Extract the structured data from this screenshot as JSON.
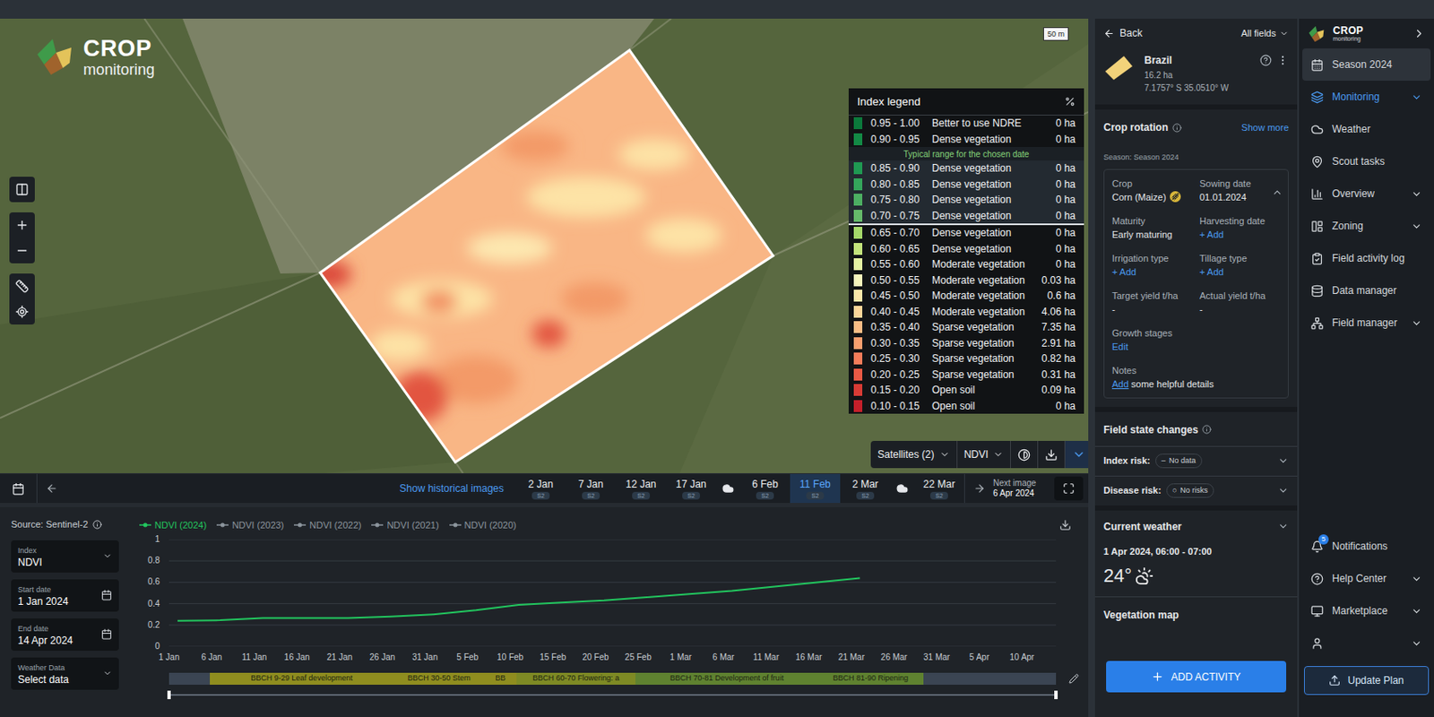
{
  "logo": {
    "title": "CROP",
    "subtitle": "monitoring"
  },
  "map": {
    "scale": "50 m",
    "legend": {
      "title": "Index legend",
      "typical_note": "Typical range for the chosen date",
      "rows": [
        {
          "range": "0.95 - 1.00",
          "label": "Better to use NDRE",
          "area": "0 ha",
          "color": "#0b7a3b",
          "typical": false
        },
        {
          "range": "0.90 - 0.95",
          "label": "Dense vegetation",
          "area": "0 ha",
          "color": "#138a45",
          "typical": false
        },
        {
          "range": "0.85 - 0.90",
          "label": "Dense vegetation",
          "area": "0 ha",
          "color": "#1f9a52",
          "typical": true
        },
        {
          "range": "0.80 - 0.85",
          "label": "Dense vegetation",
          "area": "0 ha",
          "color": "#34a65b",
          "typical": true
        },
        {
          "range": "0.75 - 0.80",
          "label": "Dense vegetation",
          "area": "0 ha",
          "color": "#4caf62",
          "typical": true
        },
        {
          "range": "0.70 - 0.75",
          "label": "Dense vegetation",
          "area": "0 ha",
          "color": "#66bb6a",
          "typical": true
        },
        {
          "range": "0.65 - 0.70",
          "label": "Dense vegetation",
          "area": "0 ha",
          "color": "#a6d96a",
          "typical": false
        },
        {
          "range": "0.60 - 0.65",
          "label": "Dense vegetation",
          "area": "0 ha",
          "color": "#c4e47c",
          "typical": false
        },
        {
          "range": "0.55 - 0.60",
          "label": "Moderate vegetation",
          "area": "0 ha",
          "color": "#e4f1a2",
          "typical": false
        },
        {
          "range": "0.50 - 0.55",
          "label": "Moderate vegetation",
          "area": "0.03 ha",
          "color": "#f7f5bc",
          "typical": false
        },
        {
          "range": "0.45 - 0.50",
          "label": "Moderate vegetation",
          "area": "0.6 ha",
          "color": "#fce8aa",
          "typical": false
        },
        {
          "range": "0.40 - 0.45",
          "label": "Moderate vegetation",
          "area": "4.06 ha",
          "color": "#fcd699",
          "typical": false
        },
        {
          "range": "0.35 - 0.40",
          "label": "Sparse vegetation",
          "area": "7.35 ha",
          "color": "#fbbd85",
          "typical": false
        },
        {
          "range": "0.30 - 0.35",
          "label": "Sparse vegetation",
          "area": "2.91 ha",
          "color": "#f99f6f",
          "typical": false
        },
        {
          "range": "0.25 - 0.30",
          "label": "Sparse vegetation",
          "area": "0.82 ha",
          "color": "#f47c5a",
          "typical": false
        },
        {
          "range": "0.20 - 0.25",
          "label": "Sparse vegetation",
          "area": "0.31 ha",
          "color": "#ea5a45",
          "typical": false
        },
        {
          "range": "0.15 - 0.20",
          "label": "Open soil",
          "area": "0.09 ha",
          "color": "#d93b35",
          "typical": false
        },
        {
          "range": "0.10 - 0.15",
          "label": "Open soil",
          "area": "0 ha",
          "color": "#c41f2a",
          "typical": false
        }
      ]
    },
    "controls": {
      "satellites": "Satellites (2)",
      "index": "NDVI"
    }
  },
  "timeline": {
    "link": "Show historical images",
    "items": [
      {
        "kind": "date",
        "label": "2 Jan",
        "badge": "S2",
        "selected": false
      },
      {
        "kind": "date",
        "label": "7 Jan",
        "badge": "S2",
        "selected": false
      },
      {
        "kind": "date",
        "label": "12 Jan",
        "badge": "S2",
        "selected": false
      },
      {
        "kind": "date",
        "label": "17 Jan",
        "badge": "S2",
        "selected": false
      },
      {
        "kind": "cloud",
        "selected": false
      },
      {
        "kind": "date",
        "label": "6 Feb",
        "badge": "S2",
        "selected": false
      },
      {
        "kind": "date",
        "label": "11 Feb",
        "badge": "S2",
        "selected": true
      },
      {
        "kind": "date",
        "label": "2 Mar",
        "badge": "S2",
        "selected": false
      },
      {
        "kind": "cloud",
        "selected": false
      },
      {
        "kind": "date",
        "label": "22 Mar",
        "badge": "S2",
        "selected": false
      }
    ],
    "next": {
      "label": "Next image",
      "date": "6 Apr 2024"
    }
  },
  "chart_panel": {
    "source": "Source: Sentinel-2",
    "fields": [
      {
        "label": "Index",
        "value": "NDVI",
        "kind": "select"
      },
      {
        "label": "Start date",
        "value": "1 Jan 2024",
        "kind": "date"
      },
      {
        "label": "End date",
        "value": "14 Apr 2024",
        "kind": "date"
      },
      {
        "label": "Weather Data",
        "value": "Select data",
        "kind": "select"
      }
    ],
    "series": [
      {
        "label": "NDVI (2024)",
        "active": true,
        "color": "#22c55e"
      },
      {
        "label": "NDVI (2023)",
        "active": false,
        "color": "#8b949c"
      },
      {
        "label": "NDVI (2022)",
        "active": false,
        "color": "#8b949c"
      },
      {
        "label": "NDVI (2021)",
        "active": false,
        "color": "#8b949c"
      },
      {
        "label": "NDVI (2020)",
        "active": false,
        "color": "#8b949c"
      }
    ],
    "y_ticks": [
      "1",
      "0.8",
      "0.6",
      "0.4",
      "0.2",
      "0"
    ],
    "x_ticks": [
      {
        "label": "1 Jan",
        "day": 0
      },
      {
        "label": "6 Jan",
        "day": 5
      },
      {
        "label": "11 Jan",
        "day": 10
      },
      {
        "label": "16 Jan",
        "day": 15
      },
      {
        "label": "21 Jan",
        "day": 20
      },
      {
        "label": "26 Jan",
        "day": 25
      },
      {
        "label": "31 Jan",
        "day": 30
      },
      {
        "label": "5 Feb",
        "day": 35
      },
      {
        "label": "10 Feb",
        "day": 40
      },
      {
        "label": "15 Feb",
        "day": 45
      },
      {
        "label": "20 Feb",
        "day": 50
      },
      {
        "label": "25 Feb",
        "day": 55
      },
      {
        "label": "1 Mar",
        "day": 60
      },
      {
        "label": "6 Mar",
        "day": 65
      },
      {
        "label": "11 Mar",
        "day": 70
      },
      {
        "label": "16 Mar",
        "day": 75
      },
      {
        "label": "21 Mar",
        "day": 80
      },
      {
        "label": "26 Mar",
        "day": 85
      },
      {
        "label": "31 Mar",
        "day": 90
      },
      {
        "label": "5 Apr",
        "day": 95
      },
      {
        "label": "10 Apr",
        "day": 100
      }
    ],
    "days_total": 104,
    "points": [
      {
        "day": 1,
        "value": 0.24
      },
      {
        "day": 6,
        "value": 0.245
      },
      {
        "day": 11,
        "value": 0.265
      },
      {
        "day": 16,
        "value": 0.265
      },
      {
        "day": 21,
        "value": 0.265
      },
      {
        "day": 26,
        "value": 0.28
      },
      {
        "day": 31,
        "value": 0.3
      },
      {
        "day": 36,
        "value": 0.34
      },
      {
        "day": 41,
        "value": 0.39
      },
      {
        "day": 46,
        "value": 0.41
      },
      {
        "day": 51,
        "value": 0.43
      },
      {
        "day": 56,
        "value": 0.46
      },
      {
        "day": 61,
        "value": 0.49
      },
      {
        "day": 66,
        "value": 0.52
      },
      {
        "day": 71,
        "value": 0.56
      },
      {
        "day": 76,
        "value": 0.6
      },
      {
        "day": 81,
        "value": 0.64
      }
    ],
    "stages": [
      {
        "label": "BBCH 9-29 Leaf development",
        "start_day": 4.8,
        "end_day": 26.3,
        "color": "#8f8d1f"
      },
      {
        "label": "BBCH 30-50 Stem",
        "start_day": 26.3,
        "end_day": 37,
        "color": "#8f8d1f"
      },
      {
        "label": "BB",
        "start_day": 37,
        "end_day": 40.7,
        "color": "#8f8d1f"
      },
      {
        "label": "BBCH 60-70 Flowering: a",
        "start_day": 40.7,
        "end_day": 54.7,
        "color": "#7e8a24"
      },
      {
        "label": "BBCH 70-81 Development of fruit",
        "start_day": 54.7,
        "end_day": 76.1,
        "color": "#5f8230"
      },
      {
        "label": "BBCH 81-90 Ripening",
        "start_day": 76.1,
        "end_day": 88.4,
        "color": "#5f8230"
      }
    ]
  },
  "field_panel": {
    "back": "Back",
    "all_fields": "All fields",
    "field": {
      "name": "Brazil",
      "area": "16.2 ha",
      "coords": "7.1757° S 35.0510° W"
    },
    "crop_rotation": {
      "title": "Crop rotation",
      "show_more": "Show more",
      "season": "Season: Season 2024",
      "expanded": true,
      "props": [
        {
          "label": "Crop",
          "value": "Corn (Maize)",
          "kind": "crop"
        },
        {
          "label": "Sowing date",
          "value": "01.01.2024",
          "kind": "text"
        },
        {
          "label": "Maturity",
          "value": "Early maturing",
          "kind": "text"
        },
        {
          "label": "Harvesting date",
          "value": "+ Add",
          "kind": "link"
        },
        {
          "label": "Irrigation type",
          "value": "+ Add",
          "kind": "link"
        },
        {
          "label": "Tillage type",
          "value": "+ Add",
          "kind": "link"
        },
        {
          "label": "Target yield t/ha",
          "value": "-",
          "kind": "text"
        },
        {
          "label": "Actual yield t/ha",
          "value": "-",
          "kind": "text"
        },
        {
          "label": "Growth stages",
          "value": "Edit",
          "kind": "link"
        }
      ],
      "notes": {
        "label": "Notes",
        "link": "Add",
        "text": "some helpful details"
      }
    },
    "field_state": {
      "title": "Field state changes",
      "risks": [
        {
          "label": "Index risk:",
          "mark": "–",
          "value": "No data",
          "expanded": false
        },
        {
          "label": "Disease risk:",
          "mark": "○",
          "value": "No risks",
          "expanded": false
        }
      ]
    },
    "weather": {
      "title": "Current weather",
      "time": "1 Apr 2024, 06:00 - 07:00",
      "temp": "24°",
      "expanded": true
    },
    "vegetation_map": "Vegetation map",
    "button": "ADD ACTIVITY"
  },
  "nav": {
    "logo": {
      "title": "CROP",
      "subtitle": "monitoring"
    },
    "items": [
      {
        "label": "Season 2024",
        "kind": "season",
        "selected": false,
        "expandable": false
      },
      {
        "label": "Monitoring",
        "kind": "item",
        "selected": true,
        "expandable": true
      },
      {
        "label": "Weather",
        "kind": "item",
        "selected": false,
        "expandable": false
      },
      {
        "label": "Scout tasks",
        "kind": "item",
        "selected": false,
        "expandable": false
      },
      {
        "label": "Overview",
        "kind": "item",
        "selected": false,
        "expandable": true
      },
      {
        "label": "Zoning",
        "kind": "item",
        "selected": false,
        "expandable": true
      },
      {
        "label": "Field activity log",
        "kind": "item",
        "selected": false,
        "expandable": false
      },
      {
        "label": "Data manager",
        "kind": "item",
        "selected": false,
        "expandable": false
      },
      {
        "label": "Field manager",
        "kind": "item",
        "selected": false,
        "expandable": true
      }
    ],
    "bottom": [
      {
        "label": "Notifications",
        "badge": "5",
        "expandable": false
      },
      {
        "label": "Help Center",
        "badge": "",
        "expandable": true
      },
      {
        "label": "Marketplace",
        "badge": "",
        "expandable": true
      },
      {
        "label": "",
        "badge": "",
        "expandable": true
      }
    ],
    "update_plan": "Update Plan"
  }
}
